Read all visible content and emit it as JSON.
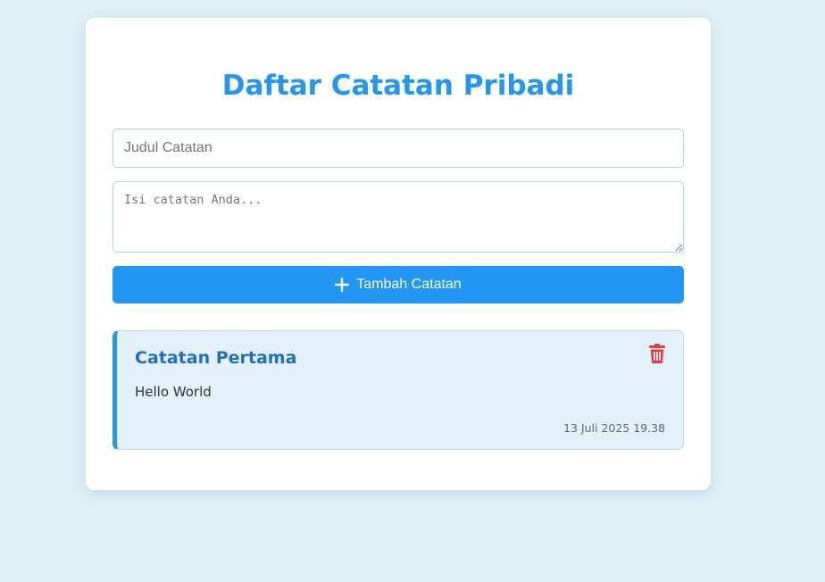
{
  "header": {
    "title": "Daftar Catatan Pribadi"
  },
  "form": {
    "title_placeholder": "Judul Catatan",
    "title_value": "",
    "content_placeholder": "Isi catatan Anda...",
    "content_value": "",
    "add_button_label": "Tambah Catatan",
    "add_button_icon": "plus-icon"
  },
  "notes": [
    {
      "title": "Catatan Pertama",
      "body": "Hello World",
      "date": "13 Juli 2025 19.38",
      "delete_icon": "trash-icon"
    }
  ],
  "colors": {
    "background": "#e0f0f7",
    "accent": "#2196f3",
    "note_background": "#e3f1fb",
    "note_title": "#1e6fbf",
    "delete": "#e53e3e"
  }
}
